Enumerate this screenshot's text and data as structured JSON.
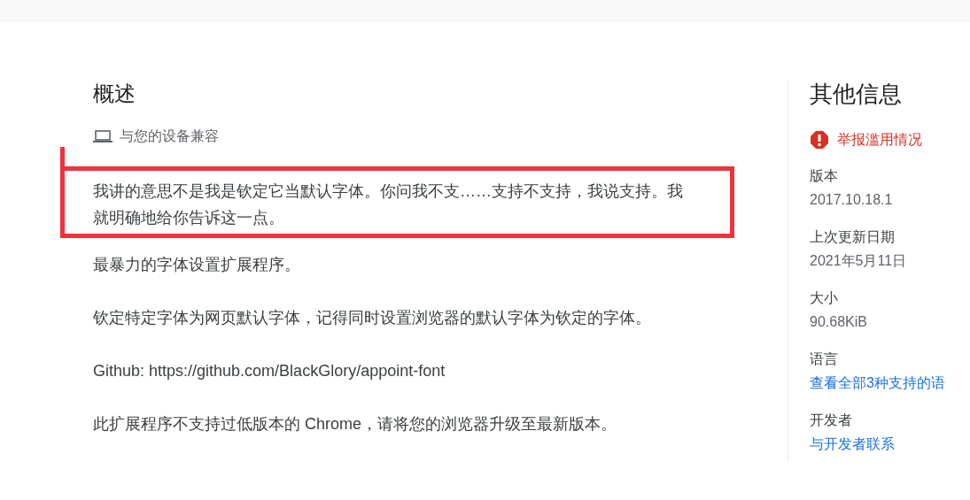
{
  "overview": {
    "title": "概述",
    "compatibility": "与您的设备兼容",
    "paragraphs": [
      {
        "text": "我讲的意思不是我是钦定它当默认字体。你问我不支……支持不支持，我说支持。我就明确地给你告诉这一点。",
        "annotated": true
      },
      {
        "text": "最暴力的字体设置扩展程序。",
        "annotated": false
      },
      {
        "text": "钦定特定字体为网页默认字体，记得同时设置浏览器的默认字体为钦定的字体。",
        "annotated": false
      },
      {
        "text": "Github: https://github.com/BlackGlory/appoint-font",
        "annotated": false
      },
      {
        "text": "此扩展程序不支持过低版本的 Chrome，请将您的浏览器升级至最新版本。",
        "annotated": false
      }
    ]
  },
  "info": {
    "title": "其他信息",
    "report": "举报滥用情况",
    "items": [
      {
        "label": "版本",
        "value": "2017.10.18.1",
        "kind": "text"
      },
      {
        "label": "上次更新日期",
        "value": "2021年5月11日",
        "kind": "text"
      },
      {
        "label": "大小",
        "value": "90.68KiB",
        "kind": "text"
      },
      {
        "label": "语言",
        "value": "查看全部3种支持的语",
        "kind": "link"
      },
      {
        "label": "开发者",
        "value": "与开发者联系",
        "kind": "link"
      }
    ]
  }
}
